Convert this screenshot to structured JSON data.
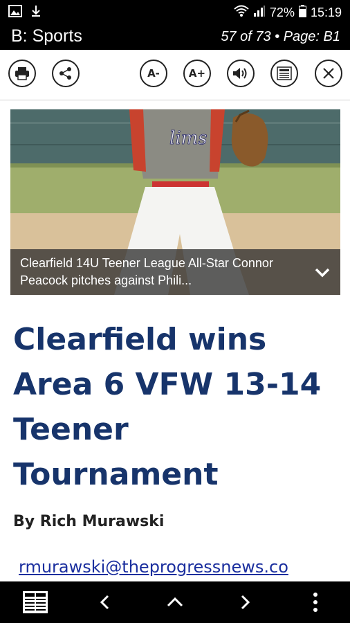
{
  "status_bar": {
    "battery": "72%",
    "time": "15:19",
    "icons": [
      "image-icon",
      "download-icon",
      "wifi-icon",
      "signal-icon",
      "battery-icon"
    ]
  },
  "header": {
    "section_title": "B: Sports",
    "page_info": "57 of 73 • Page: B1"
  },
  "toolbar": {
    "font_decrease_label": "A-",
    "font_increase_label": "A+",
    "icons": [
      "print-icon",
      "share-icon",
      "font-decrease-icon",
      "font-increase-icon",
      "speaker-icon",
      "article-view-icon",
      "close-icon"
    ]
  },
  "article": {
    "image_caption": "Clearfield 14U Teener League All-Star Connor Peacock pitches against Phili...",
    "headline": "Clearfield wins Area 6 VFW 13-14 Teener Tournament",
    "byline": "By Rich Murawski",
    "email": "rmurawski@theprogressnews.co"
  },
  "bottom_nav": {
    "icons": [
      "pages-icon",
      "previous-icon",
      "up-icon",
      "next-icon",
      "more-icon"
    ]
  },
  "colors": {
    "headline": "#17346b",
    "bars": "#000000",
    "link": "#1a2e9e"
  }
}
